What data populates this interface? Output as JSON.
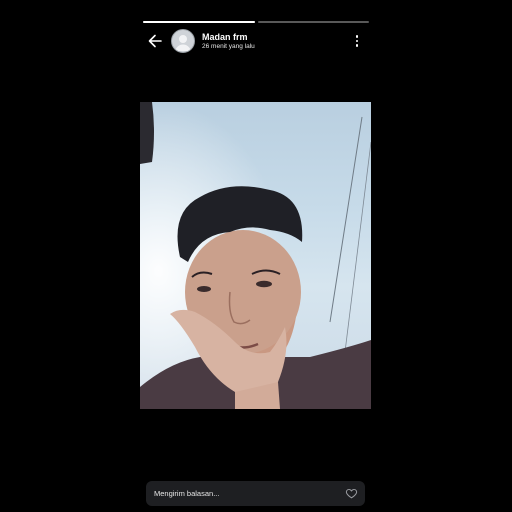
{
  "story": {
    "segments": [
      {
        "progress": 1.0
      },
      {
        "progress": 0.0
      }
    ],
    "author_name": "Madan frm",
    "posted_ago": "26 menit yang lalu"
  },
  "icons": {
    "back": "arrow-left-icon",
    "menu": "more-vertical-icon",
    "like": "heart-icon",
    "avatar": "default-avatar-icon"
  },
  "reply_bar": {
    "placeholder": "Mengirim balasan..."
  },
  "colors": {
    "background": "#000000",
    "progress_fill": "#ffffff",
    "reply_bar_bg": "#1e1f22"
  }
}
